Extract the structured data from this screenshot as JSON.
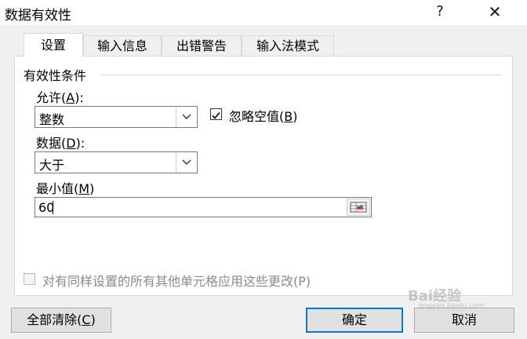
{
  "window": {
    "title": "数据有效性",
    "help_icon": "?",
    "close_icon": "✕"
  },
  "tabs": [
    {
      "label": "设置"
    },
    {
      "label": "输入信息"
    },
    {
      "label": "出错警告"
    },
    {
      "label": "输入法模式"
    }
  ],
  "validation": {
    "group_label": "有效性条件",
    "allow": {
      "label_pre": "允许(",
      "hotkey": "A",
      "label_post": "):",
      "value": "整数"
    },
    "ignore_blank": {
      "label_pre": "忽略空值(",
      "hotkey": "B",
      "label_post": ")",
      "checked": true
    },
    "data": {
      "label_pre": "数据(",
      "hotkey": "D",
      "label_post": "):",
      "value": "大于"
    },
    "minimum": {
      "label_pre": "最小值(",
      "hotkey": "M",
      "label_post": ")",
      "value": "60"
    },
    "apply_all": {
      "label": "对有同样设置的所有其他单元格应用这些更改(P)",
      "checked": false
    }
  },
  "buttons": {
    "clear_all": {
      "label_pre": "全部清除(",
      "hotkey": "C",
      "label_post": ")"
    },
    "ok": "确定",
    "cancel": "取消"
  },
  "watermark": {
    "text": "Bai经验",
    "sub": "jingyan.baidu.com"
  }
}
